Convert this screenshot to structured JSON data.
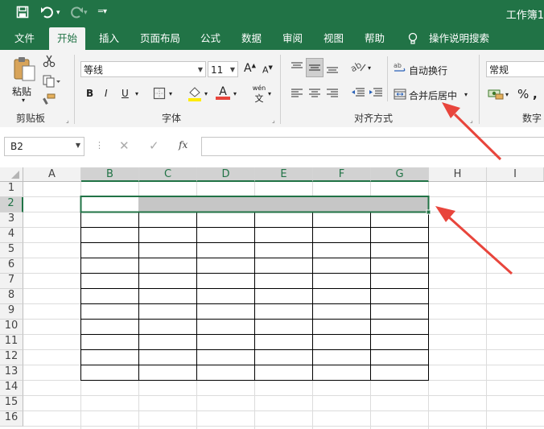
{
  "quick_access": {
    "save_icon": "save-icon",
    "undo_icon": "undo-icon",
    "redo_icon": "redo-icon",
    "customize_icon": "customize-icon"
  },
  "window": {
    "title": "工作簿1"
  },
  "tabs": [
    {
      "label": "文件"
    },
    {
      "label": "开始",
      "active": true
    },
    {
      "label": "插入"
    },
    {
      "label": "页面布局"
    },
    {
      "label": "公式"
    },
    {
      "label": "数据"
    },
    {
      "label": "审阅"
    },
    {
      "label": "视图"
    },
    {
      "label": "帮助"
    }
  ],
  "tell_me": {
    "label": "操作说明搜索"
  },
  "ribbon": {
    "clipboard": {
      "paste_label": "粘贴",
      "group_label": "剪贴板"
    },
    "font": {
      "font_name": "等线",
      "font_size": "11",
      "bold": "B",
      "italic": "I",
      "underline": "U",
      "group_label": "字体",
      "phonetic": "wén",
      "font_color_letter": "A"
    },
    "alignment": {
      "wrap_text": "自动换行",
      "merge_center": "合并后居中",
      "group_label": "对齐方式"
    },
    "number": {
      "format": "常规",
      "percent": "%",
      "group_label": "数字"
    }
  },
  "formula_bar": {
    "name_box": "B2",
    "fx": "fx",
    "content": ""
  },
  "grid": {
    "columns": [
      "A",
      "B",
      "C",
      "D",
      "E",
      "F",
      "G",
      "H",
      "I"
    ],
    "rows": [
      "1",
      "2",
      "3",
      "4",
      "5",
      "6",
      "7",
      "8",
      "9",
      "10",
      "11",
      "12",
      "13",
      "14",
      "15",
      "16"
    ],
    "selected_cell": "B2",
    "selected_range": "B2:G2"
  },
  "colors": {
    "excel_green": "#217346",
    "annotation_red": "#e8453c",
    "selection_fill": "#c6c6c6"
  }
}
